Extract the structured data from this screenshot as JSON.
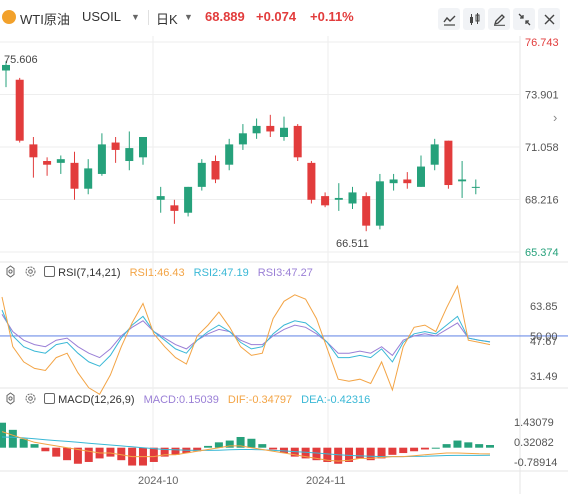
{
  "header": {
    "symbol_name": "WTI原油",
    "symbol_code": "USOIL",
    "period": "日K",
    "price": "68.889",
    "change": "+0.074",
    "change_pct": "+0.11%"
  },
  "colors": {
    "up": "#26a17b",
    "down": "#e23c3c",
    "rsi1": "#f3a445",
    "rsi2": "#3ab8d6",
    "rsi3": "#9a7fd6",
    "dif": "#f3a445",
    "dea": "#3ab8d6",
    "ref_line": "#6f8fe8",
    "grid": "#eeeeee",
    "axis_text": "#555555"
  },
  "main": {
    "price_axis": [
      "76.743",
      "73.901",
      "71.058",
      "68.216",
      "65.374"
    ],
    "high_label": "75.606",
    "low_label": "66.511",
    "ylim": [
      65.374,
      76.743
    ]
  },
  "rsi": {
    "label": "RSI(7,14,21)",
    "rsi1_label": "RSI1:46.43",
    "rsi2_label": "RSI2:47.19",
    "rsi3_label": "RSI3:47.27",
    "axis": [
      "63.85",
      "50.00",
      "47.67",
      "31.49"
    ],
    "ylim": [
      25,
      74
    ],
    "ref_value": 50,
    "rsi1": [
      68,
      45,
      38,
      35,
      34,
      40,
      42,
      33,
      26,
      23,
      32,
      45,
      56,
      65,
      51,
      45,
      40,
      37,
      50,
      55,
      61,
      54,
      45,
      41,
      42,
      58,
      66,
      69,
      67,
      58,
      44,
      30,
      29,
      30,
      28,
      38,
      25,
      45,
      54,
      55,
      52,
      63,
      73,
      48,
      47,
      46
    ],
    "rsi2": [
      62,
      50,
      45,
      43,
      42,
      46,
      47,
      42,
      38,
      36,
      41,
      49,
      55,
      59,
      52,
      48,
      44,
      42,
      48,
      52,
      55,
      52,
      47,
      44,
      45,
      51,
      55,
      57,
      56,
      52,
      47,
      40,
      40,
      41,
      40,
      44,
      38,
      47,
      51,
      52,
      51,
      55,
      59,
      49,
      48,
      47.19
    ],
    "rsi3": [
      60,
      52,
      48,
      46,
      45,
      48,
      49,
      45,
      42,
      40,
      44,
      50,
      54,
      57,
      52,
      49,
      46,
      44,
      48,
      51,
      53,
      52,
      48,
      46,
      46,
      50,
      53,
      55,
      54,
      51,
      47,
      42,
      42,
      43,
      42,
      45,
      41,
      48,
      50,
      51,
      50,
      53,
      56,
      49,
      48,
      47.27
    ]
  },
  "macd": {
    "label": "MACD(12,26,9)",
    "macd_label": "MACD:0.15039",
    "dif_label": "DIF:-0.34797",
    "dea_label": "DEA:-0.42316",
    "axis": [
      "1.43079",
      "0.32082",
      "-0.78914"
    ],
    "ylim": [
      -1.25,
      2.0
    ],
    "hist": [
      1.4,
      1.0,
      0.5,
      0.2,
      -0.2,
      -0.5,
      -0.7,
      -0.9,
      -0.8,
      -0.6,
      -0.5,
      -0.7,
      -1.0,
      -1.0,
      -0.8,
      -0.5,
      -0.4,
      -0.3,
      -0.2,
      0.1,
      0.3,
      0.4,
      0.6,
      0.5,
      0.2,
      -0.1,
      -0.3,
      -0.5,
      -0.6,
      -0.7,
      -0.8,
      -0.9,
      -0.8,
      -0.6,
      -0.7,
      -0.6,
      -0.4,
      -0.3,
      -0.2,
      -0.1,
      0.0,
      0.2,
      0.4,
      0.3,
      0.2,
      0.15
    ],
    "dif": [
      0.9,
      0.7,
      0.5,
      0.3,
      0.2,
      0.1,
      0.0,
      -0.1,
      -0.2,
      -0.3,
      -0.3,
      -0.4,
      -0.5,
      -0.5,
      -0.5,
      -0.4,
      -0.4,
      -0.3,
      -0.2,
      -0.1,
      0.0,
      0.1,
      0.1,
      0.0,
      -0.1,
      -0.2,
      -0.3,
      -0.4,
      -0.5,
      -0.6,
      -0.7,
      -0.75,
      -0.7,
      -0.6,
      -0.6,
      -0.55,
      -0.5,
      -0.5,
      -0.45,
      -0.4,
      -0.35,
      -0.3,
      -0.3,
      -0.32,
      -0.34,
      -0.348
    ],
    "dea": [
      0.6,
      0.58,
      0.55,
      0.5,
      0.45,
      0.4,
      0.35,
      0.3,
      0.25,
      0.2,
      0.15,
      0.1,
      0.05,
      0.0,
      -0.05,
      -0.1,
      -0.12,
      -0.14,
      -0.15,
      -0.15,
      -0.14,
      -0.12,
      -0.1,
      -0.1,
      -0.12,
      -0.15,
      -0.18,
      -0.22,
      -0.26,
      -0.3,
      -0.35,
      -0.4,
      -0.43,
      -0.46,
      -0.48,
      -0.5,
      -0.5,
      -0.5,
      -0.49,
      -0.48,
      -0.46,
      -0.44,
      -0.43,
      -0.43,
      -0.43,
      -0.423
    ]
  },
  "x_axis": [
    "2024-10",
    "2024-11"
  ],
  "candles": [
    {
      "o": 75.2,
      "h": 75.7,
      "l": 74.3,
      "c": 75.5
    },
    {
      "o": 74.7,
      "h": 74.8,
      "l": 71.3,
      "c": 71.4
    },
    {
      "o": 71.2,
      "h": 71.6,
      "l": 69.4,
      "c": 70.5
    },
    {
      "o": 70.3,
      "h": 70.5,
      "l": 69.5,
      "c": 70.1
    },
    {
      "o": 70.2,
      "h": 70.6,
      "l": 69.6,
      "c": 70.4
    },
    {
      "o": 70.2,
      "h": 70.8,
      "l": 68.2,
      "c": 68.8
    },
    {
      "o": 68.8,
      "h": 70.4,
      "l": 68.5,
      "c": 69.9
    },
    {
      "o": 69.6,
      "h": 71.8,
      "l": 69.5,
      "c": 71.2
    },
    {
      "o": 71.3,
      "h": 71.6,
      "l": 70.2,
      "c": 70.9
    },
    {
      "o": 70.3,
      "h": 71.9,
      "l": 69.8,
      "c": 71.0
    },
    {
      "o": 70.5,
      "h": 71.5,
      "l": 70.1,
      "c": 71.6
    },
    {
      "o": 68.2,
      "h": 68.9,
      "l": 67.5,
      "c": 68.4
    },
    {
      "o": 67.9,
      "h": 68.2,
      "l": 66.9,
      "c": 67.6
    },
    {
      "o": 67.5,
      "h": 68.9,
      "l": 67.3,
      "c": 68.9
    },
    {
      "o": 68.9,
      "h": 70.4,
      "l": 68.7,
      "c": 70.2
    },
    {
      "o": 70.3,
      "h": 70.6,
      "l": 69.1,
      "c": 69.3
    },
    {
      "o": 70.1,
      "h": 71.5,
      "l": 69.8,
      "c": 71.2
    },
    {
      "o": 71.2,
      "h": 72.3,
      "l": 70.9,
      "c": 71.8
    },
    {
      "o": 71.8,
      "h": 72.6,
      "l": 71.5,
      "c": 72.2
    },
    {
      "o": 72.2,
      "h": 72.8,
      "l": 71.6,
      "c": 71.9
    },
    {
      "o": 71.6,
      "h": 72.7,
      "l": 71.4,
      "c": 72.1
    },
    {
      "o": 72.2,
      "h": 72.3,
      "l": 70.3,
      "c": 70.5
    },
    {
      "o": 70.2,
      "h": 70.3,
      "l": 68.0,
      "c": 68.2
    },
    {
      "o": 68.4,
      "h": 68.6,
      "l": 67.8,
      "c": 67.9
    },
    {
      "o": 68.2,
      "h": 69.1,
      "l": 67.6,
      "c": 68.3
    },
    {
      "o": 68.0,
      "h": 68.9,
      "l": 67.7,
      "c": 68.6
    },
    {
      "o": 68.4,
      "h": 68.6,
      "l": 66.5,
      "c": 66.8
    },
    {
      "o": 66.8,
      "h": 69.6,
      "l": 66.6,
      "c": 69.2
    },
    {
      "o": 69.1,
      "h": 69.6,
      "l": 68.7,
      "c": 69.3
    },
    {
      "o": 69.3,
      "h": 69.7,
      "l": 68.8,
      "c": 69.1
    },
    {
      "o": 68.9,
      "h": 70.6,
      "l": 68.9,
      "c": 70.0
    },
    {
      "o": 70.1,
      "h": 71.5,
      "l": 69.8,
      "c": 71.2
    },
    {
      "o": 71.4,
      "h": 71.4,
      "l": 68.8,
      "c": 69.0
    },
    {
      "o": 69.2,
      "h": 70.3,
      "l": 68.3,
      "c": 69.3
    },
    {
      "o": 68.9,
      "h": 69.3,
      "l": 68.5,
      "c": 68.9
    }
  ]
}
